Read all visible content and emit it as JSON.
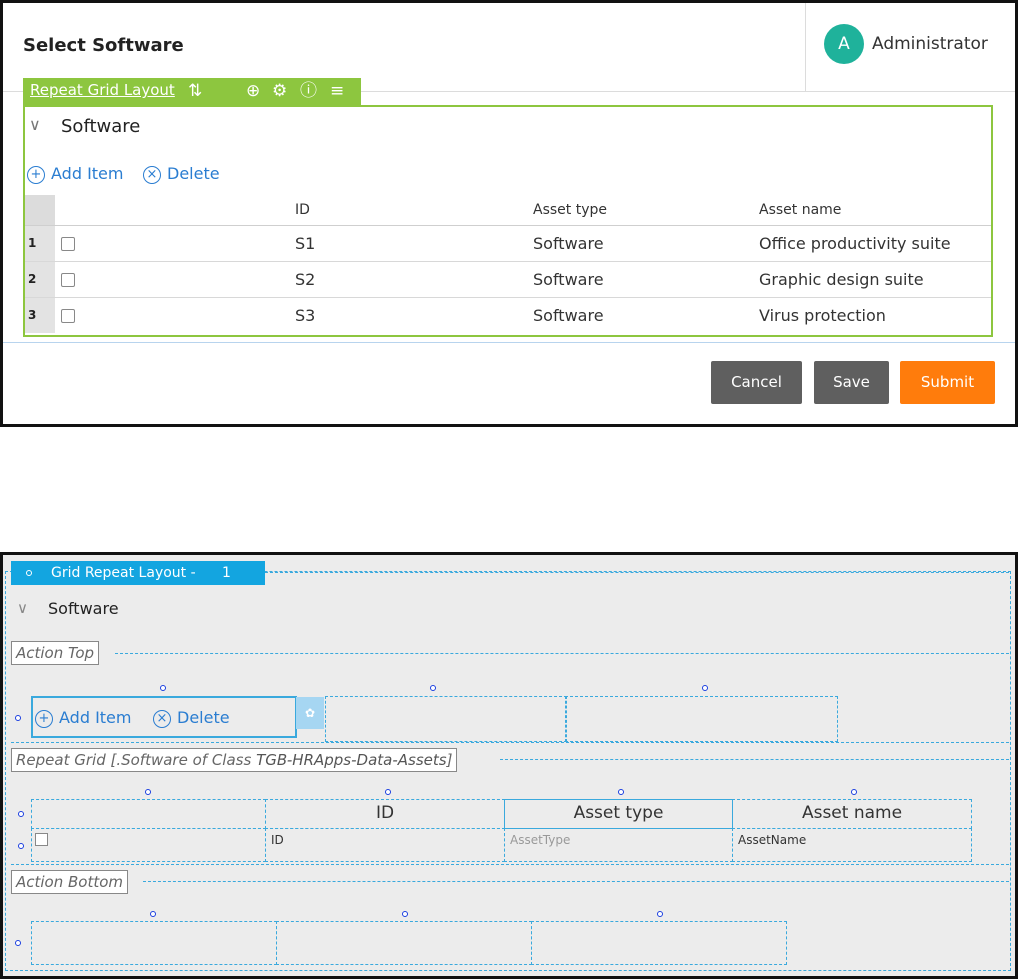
{
  "runtime": {
    "title": "Select Software",
    "user": {
      "initial": "A",
      "name": "Administrator",
      "avatar_color": "#1fb29b"
    },
    "layout_tab": {
      "label": "Repeat Grid Layout",
      "icons": [
        "sort-icon",
        "target-icon",
        "gear-icon",
        "info-icon",
        "menu-icon"
      ]
    },
    "section_title": "Software",
    "actions": {
      "add": "Add Item",
      "delete": "Delete"
    },
    "columns": [
      "ID",
      "Asset type",
      "Asset name"
    ],
    "rows": [
      {
        "num": "1",
        "id": "S1",
        "type": "Software",
        "name": "Office productivity suite"
      },
      {
        "num": "2",
        "id": "S2",
        "type": "Software",
        "name": "Graphic design suite"
      },
      {
        "num": "3",
        "id": "S3",
        "type": "Software",
        "name": "Virus protection"
      }
    ],
    "buttons": {
      "cancel": "Cancel",
      "save": "Save",
      "submit": "Submit"
    },
    "colors": {
      "accent_green": "#8dc63f",
      "submit_orange": "#ff7c0c",
      "button_grey": "#5f5f5f",
      "link_blue": "#2a7dd1"
    }
  },
  "designer": {
    "layout_tab": {
      "label": "Grid Repeat Layout -",
      "count": "1"
    },
    "section_title": "Software",
    "action_top": "Action Top",
    "actions": {
      "add": "Add Item",
      "delete": "Delete"
    },
    "repeat_grid": {
      "prefix": "Repeat Grid [.Software of Class ",
      "class": "TGB-HRApps-Data-Assets",
      "suffix": "]"
    },
    "columns": [
      "ID",
      "Asset type",
      "Asset name"
    ],
    "properties": [
      "ID",
      "AssetType",
      "AssetName"
    ],
    "action_bottom": "Action Bottom",
    "colors": {
      "tab_blue": "#13a5e0",
      "dash_blue": "#3aa9dd"
    }
  }
}
